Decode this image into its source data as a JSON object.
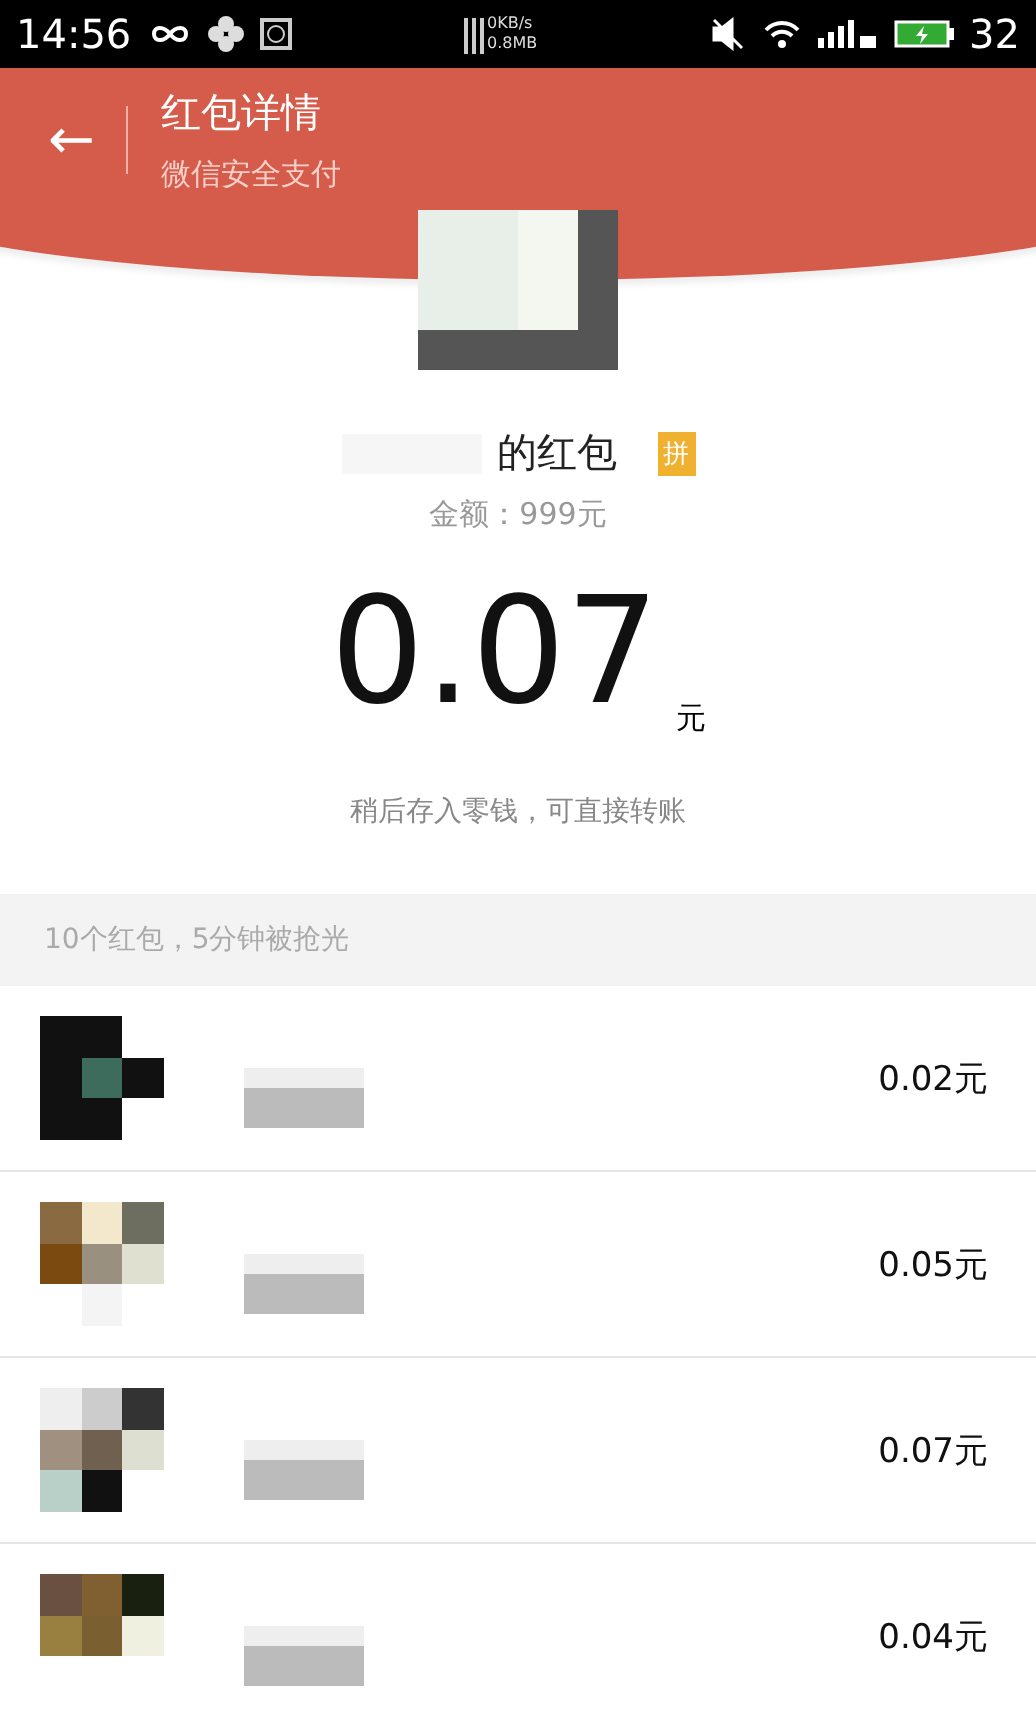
{
  "status_bar": {
    "time": "14:56",
    "net_speed": "0KB/s",
    "data_used": "0.8MB",
    "battery": "32"
  },
  "header": {
    "back": "←",
    "title": "红包详情",
    "subtitle": "微信安全支付"
  },
  "packet": {
    "sender_suffix": "的红包",
    "badge": "拼",
    "total": "金额：999元",
    "amount": "0.07",
    "unit": "元",
    "note": "稍后存入零钱，可直接转账"
  },
  "summary": "10个红包，5分钟被抢光",
  "recipients": [
    {
      "amount": "0.02元"
    },
    {
      "amount": "0.05元"
    },
    {
      "amount": "0.07元"
    },
    {
      "amount": "0.04元"
    }
  ]
}
